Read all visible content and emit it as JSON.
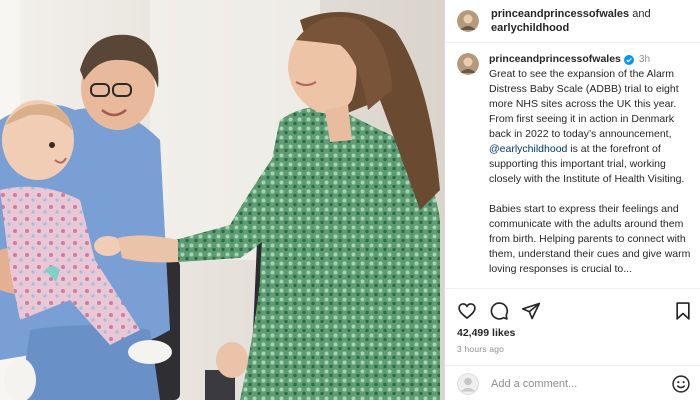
{
  "header": {
    "author": "princeandprincessofwales",
    "conjunction": "and",
    "collaborator": "earlychildhood",
    "avatar_icon": "profile-avatar"
  },
  "caption": {
    "author": "princeandprincessofwales",
    "verified_icon": "verified-badge",
    "time": "3h",
    "paragraph1_before": "Great to see the expansion of the Alarm Distress Baby Scale (ADBB) trial to eight more NHS sites across the UK this year. From first seeing it in action in Denmark back in 2022 to today’s announcement, ",
    "mention": "@earlychildhood",
    "paragraph1_after": " is at the forefront of supporting this important trial, working closely with the Institute of Health Visiting.",
    "paragraph2": "Babies start to express their feelings and communicate with the adults around them from birth. Helping parents to connect with them, understand their cues and give warm loving responses is crucial to..."
  },
  "actions": {
    "icons": [
      "heart-icon",
      "comment-icon",
      "share-icon",
      "bookmark-icon"
    ],
    "likes": "42,499 likes",
    "posted": "3 hours ago"
  },
  "comment": {
    "placeholder": "Add a comment...",
    "emoji_icon": "emoji-icon"
  },
  "colors": {
    "text": "#262626",
    "muted": "#8e8e8e",
    "mention": "#00376b",
    "verified": "#0095f6",
    "border": "#dbdbdb"
  }
}
